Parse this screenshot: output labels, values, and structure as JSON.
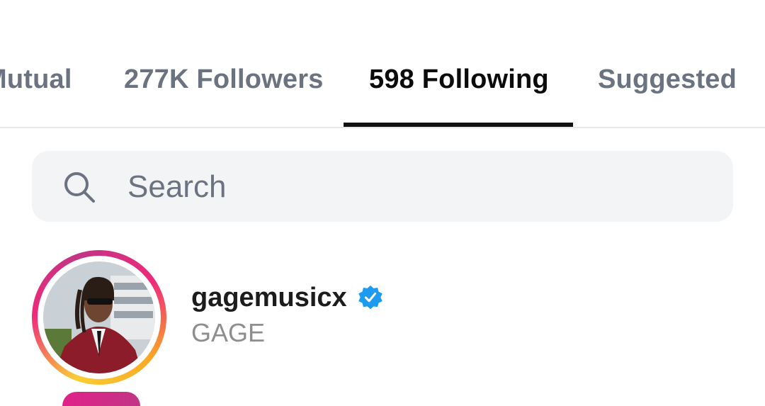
{
  "tabs": [
    {
      "label": "Mutual",
      "active": false
    },
    {
      "label": "277K Followers",
      "active": false
    },
    {
      "label": "598 Following",
      "active": true
    },
    {
      "label": "Suggested",
      "active": false
    }
  ],
  "search": {
    "placeholder": "Search",
    "value": ""
  },
  "list": [
    {
      "username": "gagemusicx",
      "verified": true,
      "full_name": "GAGE",
      "avatar_icon": "profile-photo"
    }
  ],
  "colors": {
    "active_tab": "#0b0b0b",
    "inactive_tab": "#6b7280",
    "verified_badge": "#1d9bf0",
    "search_bg": "#f3f4f6",
    "story_ring_start": "#f9ce34",
    "story_ring_end": "#c13584"
  }
}
